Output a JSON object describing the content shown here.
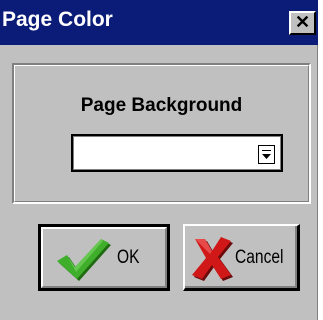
{
  "window": {
    "title": "Page Color",
    "close_glyph": "✕",
    "colors": {
      "titlebar": "#0a1b78",
      "face": "#c0c0c0",
      "title_text": "#ffffff"
    }
  },
  "group": {
    "label": "Page Background",
    "dropdown": {
      "selected_value": "",
      "arrow_icon": "dropdown-arrow-icon"
    }
  },
  "buttons": {
    "ok": {
      "label": "OK",
      "icon": "checkmark-icon",
      "icon_color": "#2e8b1a"
    },
    "cancel": {
      "label": "Cancel",
      "icon": "x-mark-icon",
      "icon_color": "#c81010"
    }
  }
}
